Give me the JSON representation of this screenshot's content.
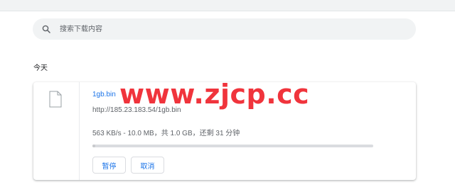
{
  "search": {
    "placeholder": "搜索下载内容",
    "icon": "search-icon"
  },
  "section": {
    "date_label": "今天"
  },
  "download": {
    "file_name": "1gb.bin",
    "url": "http://185.23.183.54/1gb.bin",
    "progress_text": "563 KB/s - 10.0 MB，共 1.0 GB，还剩 31 分钟",
    "progress_fraction": 0.01,
    "pause_label": "暂停",
    "cancel_label": "取消",
    "icon": "file-icon"
  },
  "watermark": {
    "text": "www.zjcp.cc"
  },
  "colors": {
    "accent": "#1a73e8",
    "watermark": "#f0343c"
  }
}
